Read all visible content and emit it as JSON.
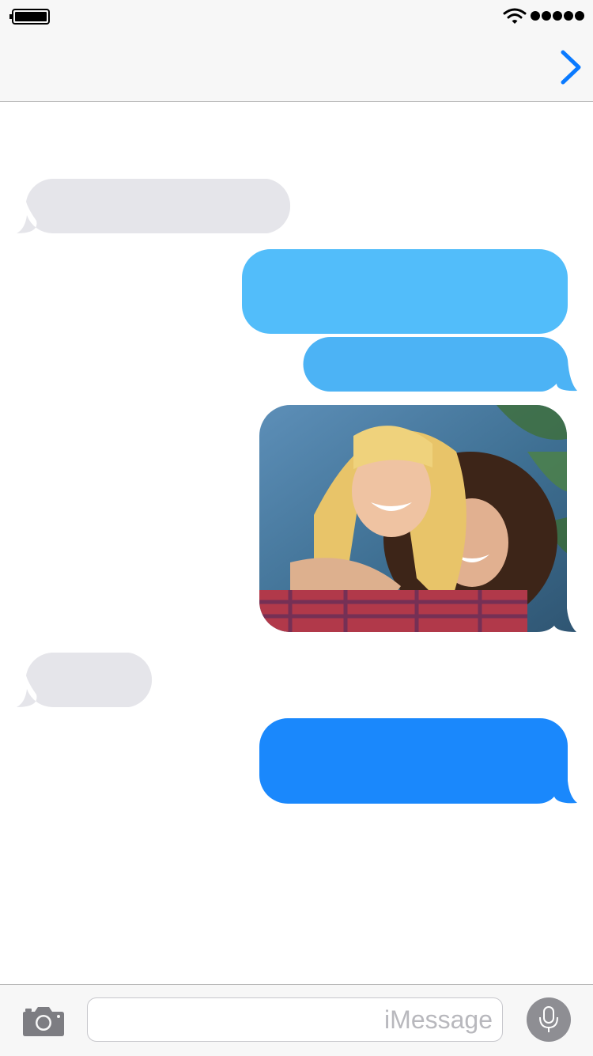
{
  "status_bar": {
    "battery_icon": "battery-full-icon",
    "wifi_icon": "wifi-icon",
    "signal_icon": "signal-dots-icon",
    "signal_strength_dots": 5
  },
  "nav_bar": {
    "details_icon": "chevron-right-icon",
    "accent_color": "#0a7aff"
  },
  "messages": [
    {
      "id": "m1",
      "direction": "received",
      "kind": "text",
      "text": "",
      "color": "#e5e5ea",
      "tail": true
    },
    {
      "id": "m2",
      "direction": "sent",
      "kind": "text",
      "text": "",
      "color": "#52bdfa",
      "tail": false
    },
    {
      "id": "m3",
      "direction": "sent",
      "kind": "text",
      "text": "",
      "color": "#4cb3f5",
      "tail": true
    },
    {
      "id": "m4",
      "direction": "sent",
      "kind": "photo",
      "text": "",
      "tail": true
    },
    {
      "id": "m5",
      "direction": "received",
      "kind": "text",
      "text": "",
      "color": "#e5e5ea",
      "tail": true
    },
    {
      "id": "m6",
      "direction": "sent",
      "kind": "text",
      "text": "",
      "color": "#1a88fc",
      "tail": true
    }
  ],
  "input_bar": {
    "camera_icon": "camera-icon",
    "placeholder": "iMessage",
    "value": "",
    "mic_icon": "microphone-icon"
  }
}
